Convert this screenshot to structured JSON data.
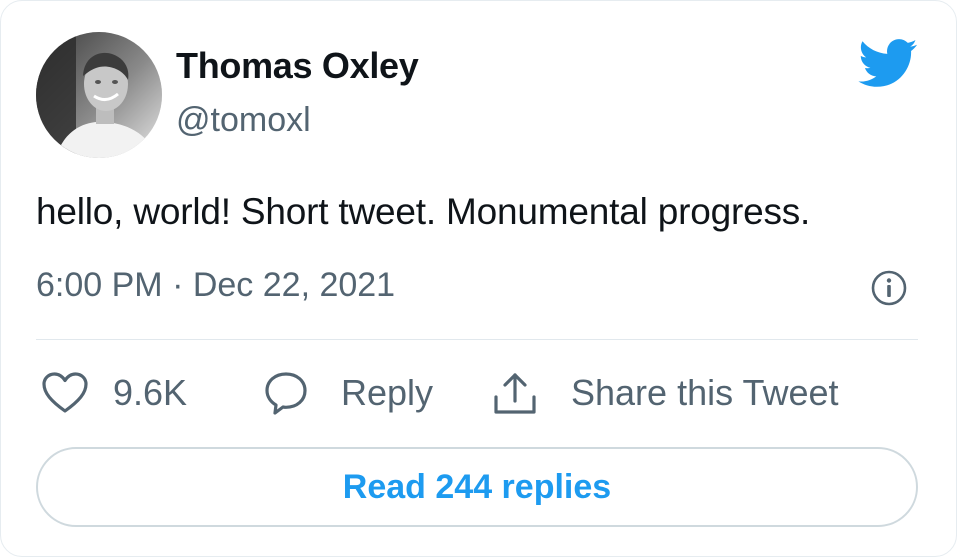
{
  "author": {
    "name": "Thomas Oxley",
    "handle": "@tomoxl"
  },
  "tweet": {
    "text": "hello, world! Short tweet. Monumental progress.",
    "timestamp": "6:00 PM · Dec 22, 2021"
  },
  "actions": {
    "like_count": "9.6K",
    "reply_label": "Reply",
    "share_label": "Share this Tweet"
  },
  "footer": {
    "read_replies_label": "Read 244 replies"
  },
  "icons": {
    "logo": "twitter-bird-icon",
    "info": "info-icon",
    "like": "heart-icon",
    "reply": "speech-bubble-icon",
    "share": "share-upload-icon"
  },
  "colors": {
    "brand": "#1d9bf0",
    "text_primary": "#0f1419",
    "text_secondary": "#536471",
    "border": "#cfd9de"
  }
}
